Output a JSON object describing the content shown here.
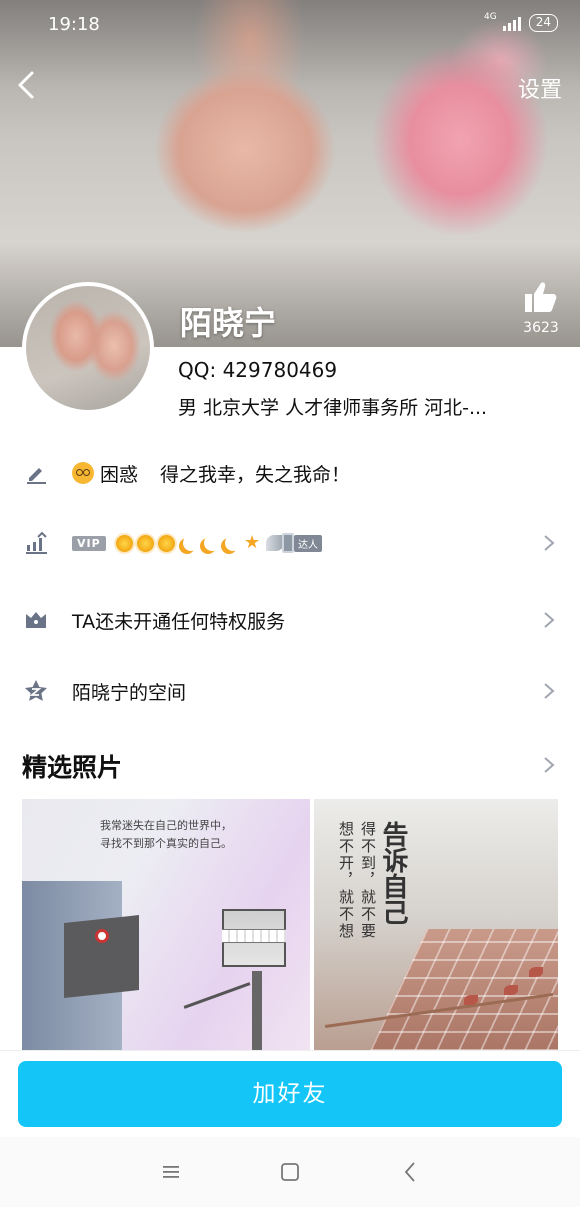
{
  "status_bar": {
    "time": "19:18",
    "network": "4G",
    "battery": "24"
  },
  "header": {
    "settings_label": "设置",
    "nickname": "陌晓宁",
    "like_count": "3623"
  },
  "profile": {
    "qq_label": "QQ: 429780469",
    "details": "男  北京大学  人才律师事务所  河北-..."
  },
  "signature": {
    "mood": "困惑",
    "text": "得之我幸，失之我命！"
  },
  "level_row": {
    "vip_label": "VIP",
    "daren_label": "达人"
  },
  "privilege_row": {
    "label": "TA还未开通任何特权服务"
  },
  "space_row": {
    "label": "陌晓宁的空间"
  },
  "photos": {
    "section_title": "精选照片",
    "photo1_caption_line1": "我常迷失在自己的世界中，",
    "photo1_caption_line2": "寻找不到那个真实的自己。",
    "photo2_poem_col1": "想不开，就不想",
    "photo2_poem_col2": "得不到，就不要",
    "photo2_title": "告诉自己"
  },
  "action": {
    "add_friend_label": "加好友"
  },
  "colors": {
    "accent": "#13c6f7",
    "icon_gray": "#6b7486"
  }
}
